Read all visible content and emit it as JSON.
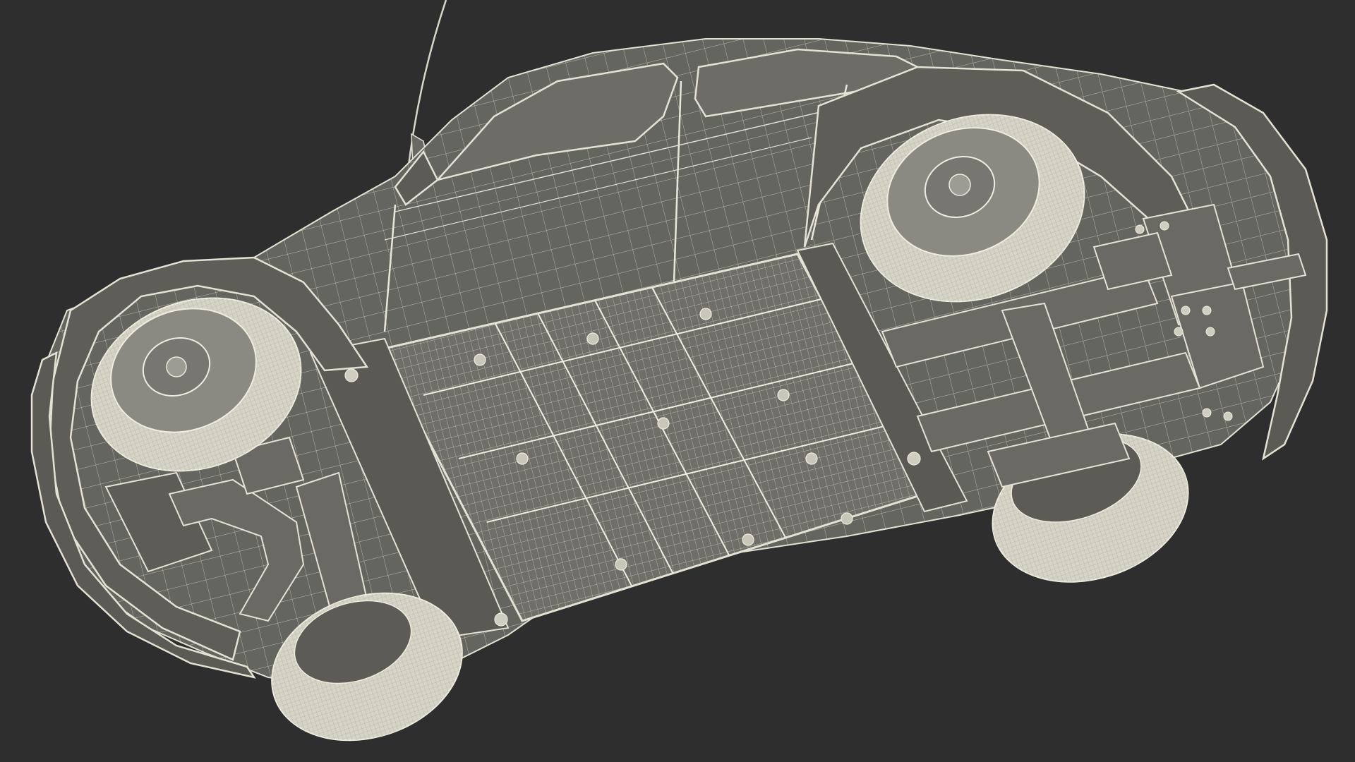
{
  "scene": {
    "subject": "wireframe-car-underside",
    "colors": {
      "background": "#2e2e2e",
      "body_fill": "#656560",
      "body_fill_dark": "#545450",
      "body_fill_light": "#76756f",
      "wire": "#e4e2d4",
      "wire_dim": "#b9b7aa",
      "tire_fill": "#d6d4c6",
      "hub_fill": "#8a8982",
      "shadow": "#3f3f3c"
    },
    "elements": {
      "wheels": 4,
      "wheel_positions": [
        "front-left",
        "front-right",
        "rear-left",
        "rear-right"
      ]
    }
  }
}
